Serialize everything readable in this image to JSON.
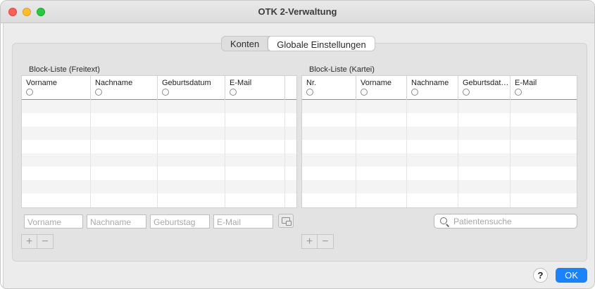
{
  "window": {
    "title": "OTK 2-Verwaltung"
  },
  "tabs": [
    {
      "label": "Konten",
      "active": false
    },
    {
      "label": "Globale Einstellungen",
      "active": true
    }
  ],
  "left_list": {
    "label": "Block-Liste (Freitext)",
    "columns": [
      "Vorname",
      "Nachname",
      "Geburtsdatum",
      "E-Mail"
    ],
    "filters": [
      {
        "placeholder": "Vorname"
      },
      {
        "placeholder": "Nachname"
      },
      {
        "placeholder": "Geburtstag"
      },
      {
        "placeholder": "E-Mail"
      }
    ],
    "add_label": "+",
    "remove_label": "−"
  },
  "right_list": {
    "label": "Block-Liste (Kartei)",
    "columns": [
      "Nr.",
      "Vorname",
      "Nachname",
      "Geburtsdat…",
      "E-Mail"
    ],
    "add_label": "+",
    "remove_label": "−"
  },
  "search": {
    "placeholder": "Patientensuche"
  },
  "footer": {
    "help_label": "?",
    "ok_label": "OK"
  },
  "colors": {
    "accent": "#1a82fb",
    "close": "#ff5f57",
    "minimize": "#febc2e",
    "maximize": "#28c840"
  },
  "icons": [
    "close-icon",
    "minimize-icon",
    "maximize-icon",
    "filter-options-icon",
    "search-icon"
  ]
}
